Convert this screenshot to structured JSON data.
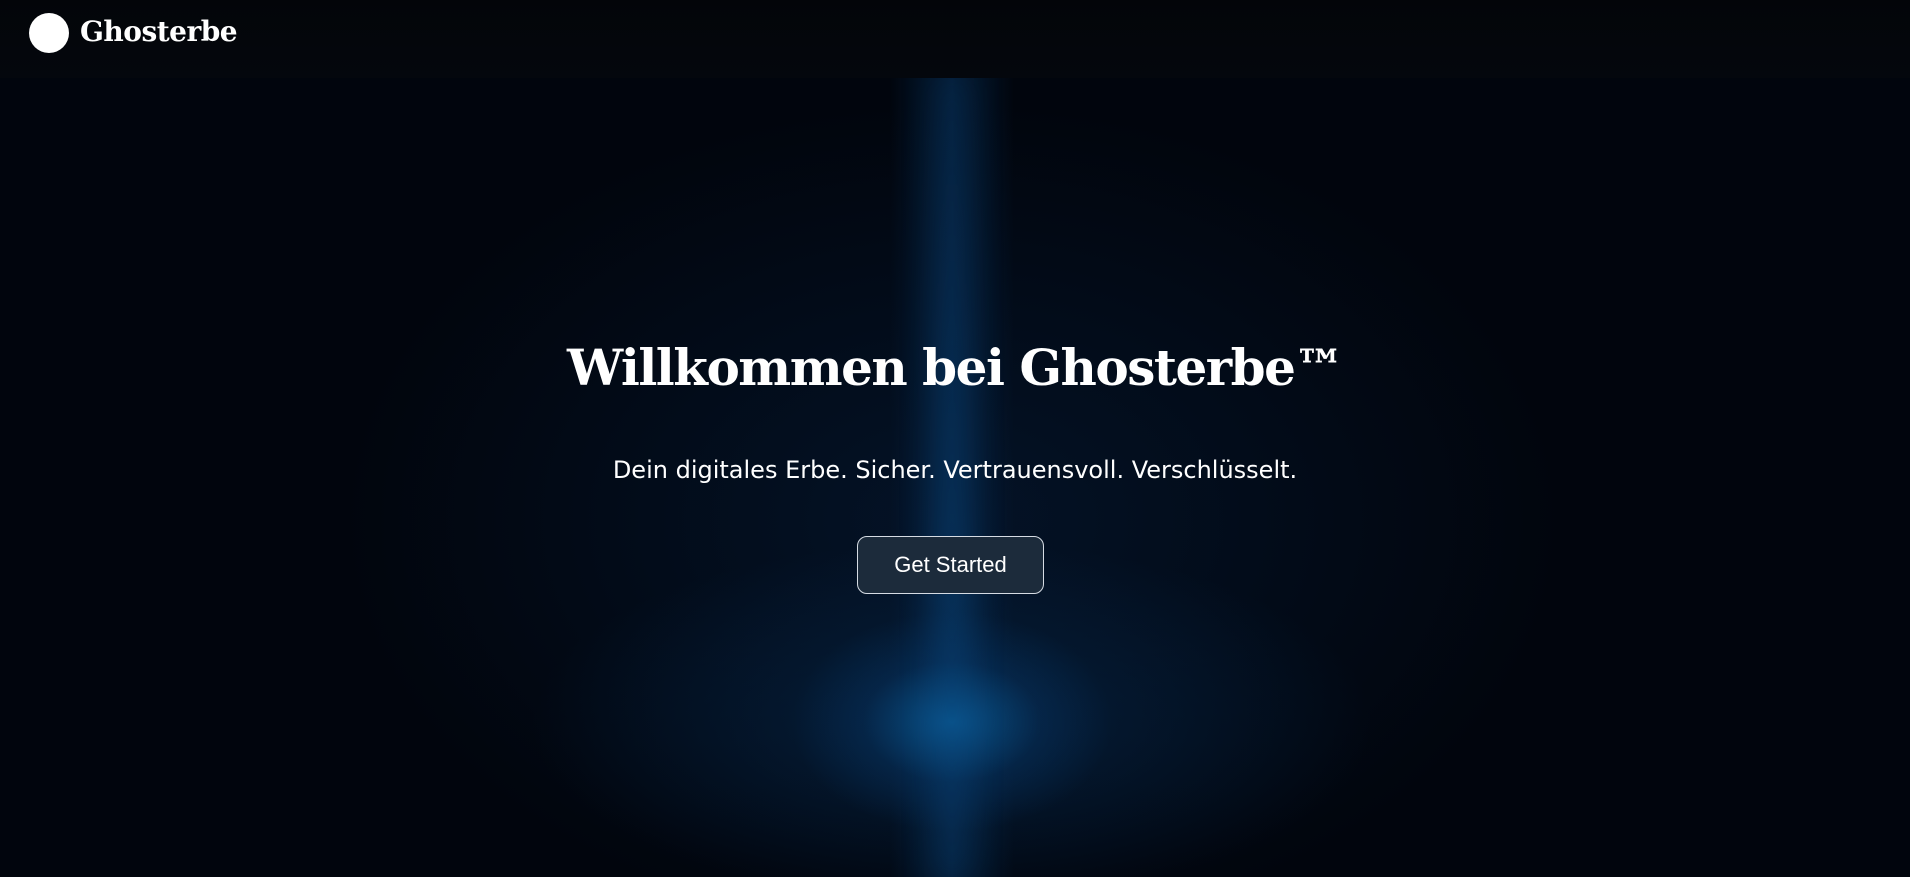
{
  "header": {
    "brand": "Ghosterbe",
    "logo_icon": "white-circle-logo-icon"
  },
  "hero": {
    "title": "Willkommen bei Ghosterbe™",
    "subtitle": "Dein digitales Erbe. Sicher. Vertrauensvoll. Verschlüsselt.",
    "cta_label": "Get Started"
  },
  "colors": {
    "background": "#01050d",
    "glow": "#0a548c",
    "button_background": "#1c2b3b",
    "button_border": "#d6dce4",
    "text": "#ffffff"
  }
}
